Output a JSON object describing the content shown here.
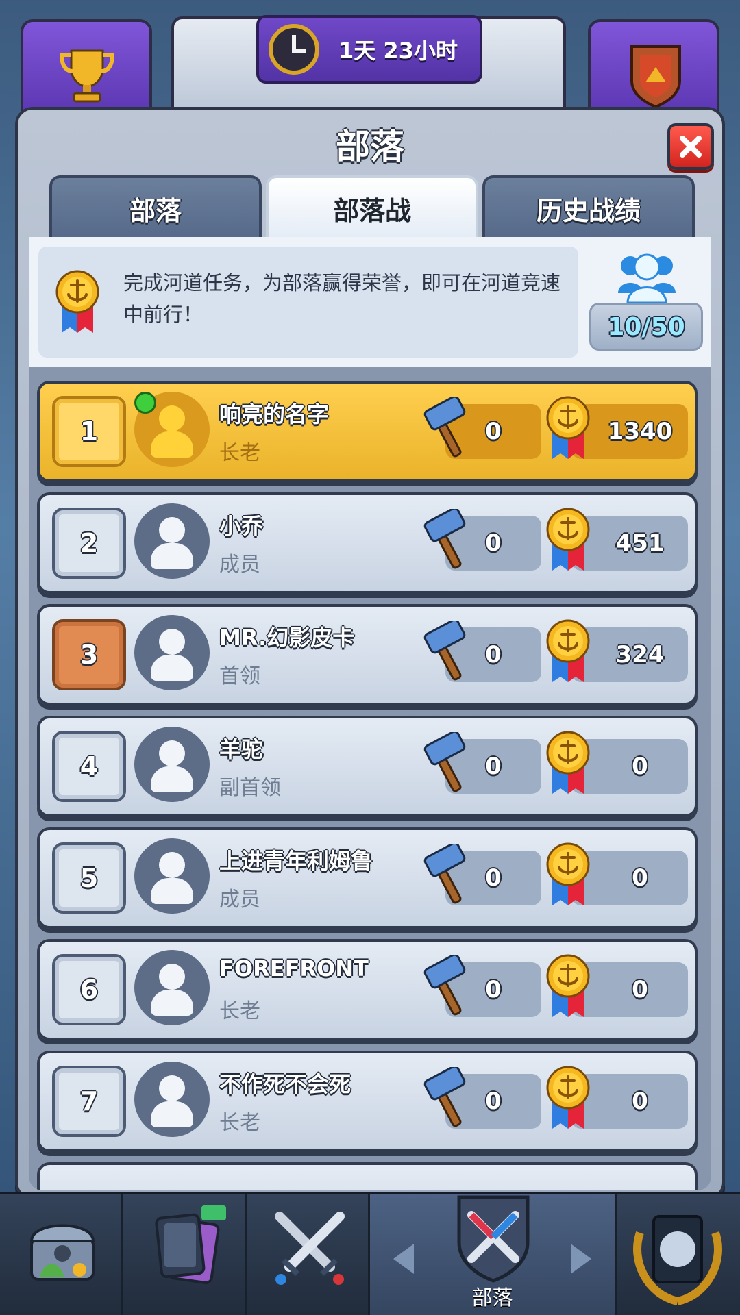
{
  "header": {
    "timer": "1天 23小时"
  },
  "panel": {
    "title": "部落",
    "tabs": [
      {
        "label": "部落"
      },
      {
        "label": "部落战"
      },
      {
        "label": "历史战绩"
      }
    ],
    "info": {
      "text": "完成河道任务，为部落赢得荣誉，即可在河道竞速中前行！",
      "participants": "10/50"
    }
  },
  "members": [
    {
      "rank": "1",
      "name": "响亮的名字",
      "role": "长老",
      "decks": "0",
      "fame": "1340"
    },
    {
      "rank": "2",
      "name": "小乔",
      "role": "成员",
      "decks": "0",
      "fame": "451"
    },
    {
      "rank": "3",
      "name": "MR.幻影皮卡",
      "role": "首领",
      "decks": "0",
      "fame": "324"
    },
    {
      "rank": "4",
      "name": "羊驼",
      "role": "副首领",
      "decks": "0",
      "fame": "0"
    },
    {
      "rank": "5",
      "name": "上进青年利姆鲁",
      "role": "成员",
      "decks": "0",
      "fame": "0"
    },
    {
      "rank": "6",
      "name": "FOREFRONT",
      "role": "长老",
      "decks": "0",
      "fame": "0"
    },
    {
      "rank": "7",
      "name": "不作死不会死",
      "role": "长老",
      "decks": "0",
      "fame": "0"
    }
  ],
  "bottom_nav": {
    "active_label": "部落"
  },
  "colors": {
    "gold_row": "#f2bd3a",
    "close_button": "#e0302a",
    "accent_purple": "#6a42c2"
  }
}
